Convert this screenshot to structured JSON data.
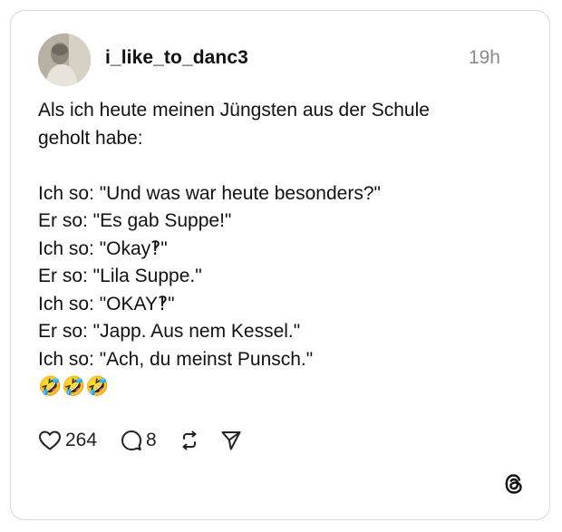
{
  "post": {
    "username": "i_like_to_danc3",
    "time": "19h",
    "text_lines": [
      "Als ich heute meinen Jüngsten aus der Schule",
      "geholt habe:",
      "",
      "Ich so: \"Und was war heute besonders?\"",
      "Er so: \"Es gab Suppe!\"",
      "Ich so: \"Okay‽\"",
      "Er so: \"Lila Suppe.\"",
      "Ich so: \"OKAY‽\"",
      "Er so: \"Japp. Aus nem Kessel.\"",
      "Ich so: \"Ach, du meinst Punsch.\"",
      "🤣🤣🤣"
    ]
  },
  "actions": {
    "like_count": "264",
    "reply_count": "8"
  },
  "icons": {
    "like": "heart-icon",
    "reply": "comment-icon",
    "repost": "repost-icon",
    "share": "send-icon",
    "brand": "threads-logo-icon"
  },
  "colors": {
    "text": "#111111",
    "muted": "#8a8a8a",
    "border": "#d9d9d9",
    "emoji": "#f5b82e"
  }
}
